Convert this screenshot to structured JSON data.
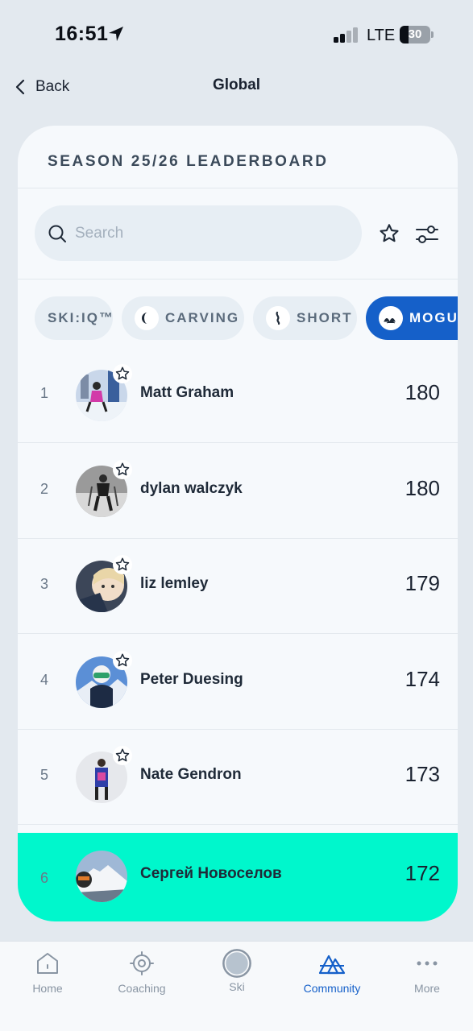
{
  "status_bar": {
    "time": "16:51",
    "carrier": "LTE",
    "battery": "30",
    "battery_level": 0.3
  },
  "nav": {
    "back_label": "Back",
    "title": "Global"
  },
  "card": {
    "title": "SEASON 25/26 LEADERBOARD"
  },
  "search": {
    "placeholder": "Search",
    "value": ""
  },
  "chips": [
    {
      "label": "SKI:IQ™",
      "icon": ""
    },
    {
      "label": "CARVING",
      "icon": "carving-icon"
    },
    {
      "label": "SHORT",
      "icon": "short-turn-icon"
    },
    {
      "label": "MOGULS",
      "icon": "moguls-icon",
      "active": true
    }
  ],
  "leaderboard": [
    {
      "rank": "1",
      "name": "Matt Graham",
      "score": "180"
    },
    {
      "rank": "2",
      "name": "dylan walczyk",
      "score": "180"
    },
    {
      "rank": "3",
      "name": "liz lemley",
      "score": "179"
    },
    {
      "rank": "4",
      "name": "Peter Duesing",
      "score": "174"
    },
    {
      "rank": "5",
      "name": "Nate Gendron",
      "score": "173"
    },
    {
      "rank": "6",
      "name": "Сергей Новоселов",
      "score": "172",
      "current_user": true
    }
  ],
  "tabs": [
    {
      "label": "Home",
      "icon": "home-icon"
    },
    {
      "label": "Coaching",
      "icon": "target-icon"
    },
    {
      "label": "Ski",
      "icon": "ski-icon"
    },
    {
      "label": "Community",
      "icon": "mountains-icon",
      "active": true
    },
    {
      "label": "More",
      "icon": "more-icon"
    }
  ],
  "colors": {
    "accent": "#1560c9",
    "highlight": "#00f7cc",
    "background": "#e3e9ef",
    "card": "#f6f9fc"
  }
}
